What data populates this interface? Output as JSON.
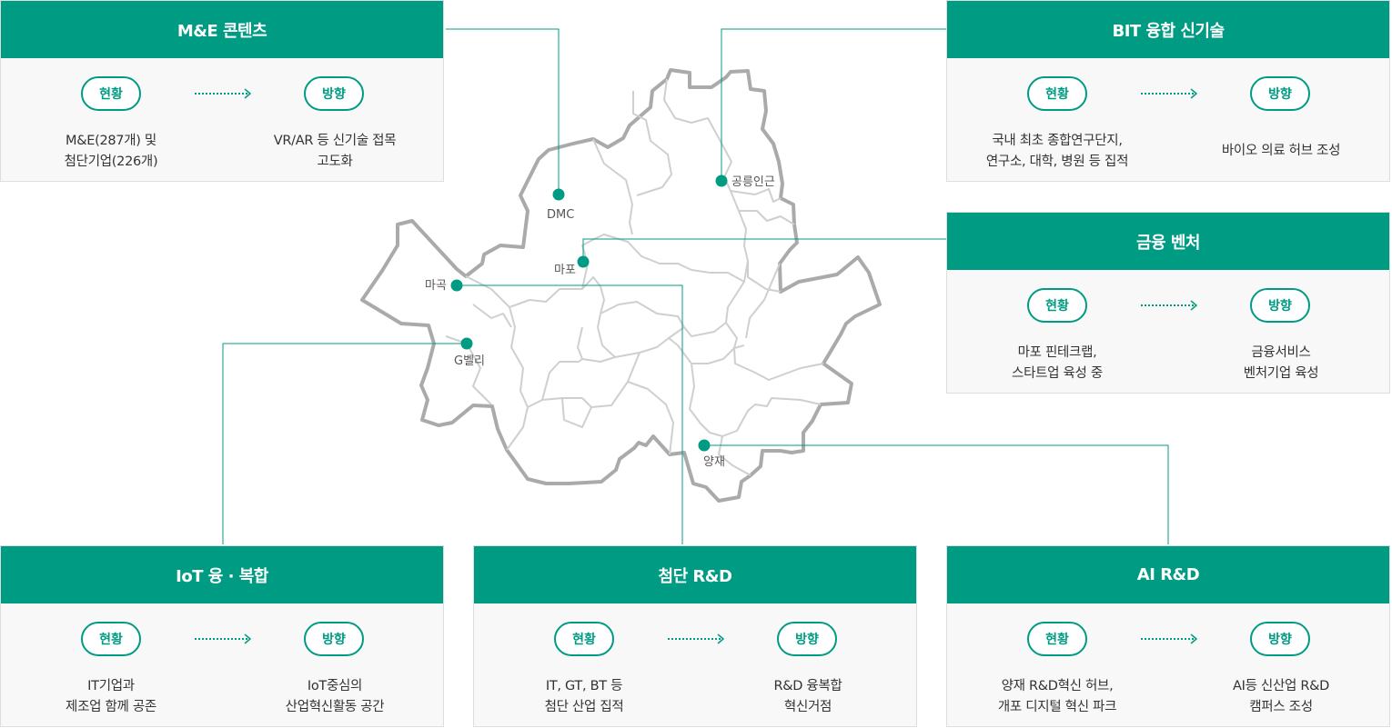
{
  "labels": {
    "current": "현황",
    "direction": "방향"
  },
  "cards": {
    "me": {
      "title": "M&E 콘텐츠",
      "current": [
        "M&E(287개) 및",
        "첨단기업(226개)"
      ],
      "direction": [
        "VR/AR 등 신기술 접목",
        "고도화"
      ]
    },
    "bit": {
      "title": "BIT 융합 신기술",
      "current": [
        "국내 최초 종합연구단지,",
        "연구소, 대학, 병원 등 집적"
      ],
      "direction": [
        "바이오 의료 허브 조성"
      ]
    },
    "finance": {
      "title": "금융 벤처",
      "current": [
        "마포 핀테크랩,",
        "스타트업 육성 중"
      ],
      "direction": [
        "금융서비스",
        "벤처기업 육성"
      ]
    },
    "iot": {
      "title": "IoT 융 · 복합",
      "current": [
        "IT기업과",
        "제조업 함께 공존"
      ],
      "direction": [
        "IoT중심의",
        "산업혁신활동 공간"
      ]
    },
    "rnd": {
      "title": "첨단 R&D",
      "current": [
        "IT, GT, BT 등",
        "첨단 산업 집적"
      ],
      "direction": [
        "R&D 융복합",
        "혁신거점"
      ]
    },
    "ai": {
      "title": "AI R&D",
      "current": [
        "양재 R&D혁신 허브,",
        "개포 디지털 혁신 파크"
      ],
      "direction": [
        "AI등 신산업 R&D",
        "캠퍼스 조성"
      ]
    }
  },
  "map": {
    "places": {
      "dmc": "DMC",
      "hongneung": "공릉인근",
      "mapo": "마포",
      "magok": "마곡",
      "gvalley": "G벨리",
      "yangjae": "양재"
    }
  },
  "colors": {
    "accent": "#009b83",
    "map_outline": "#aaaaaa",
    "map_inner": "#cfcfcf"
  }
}
